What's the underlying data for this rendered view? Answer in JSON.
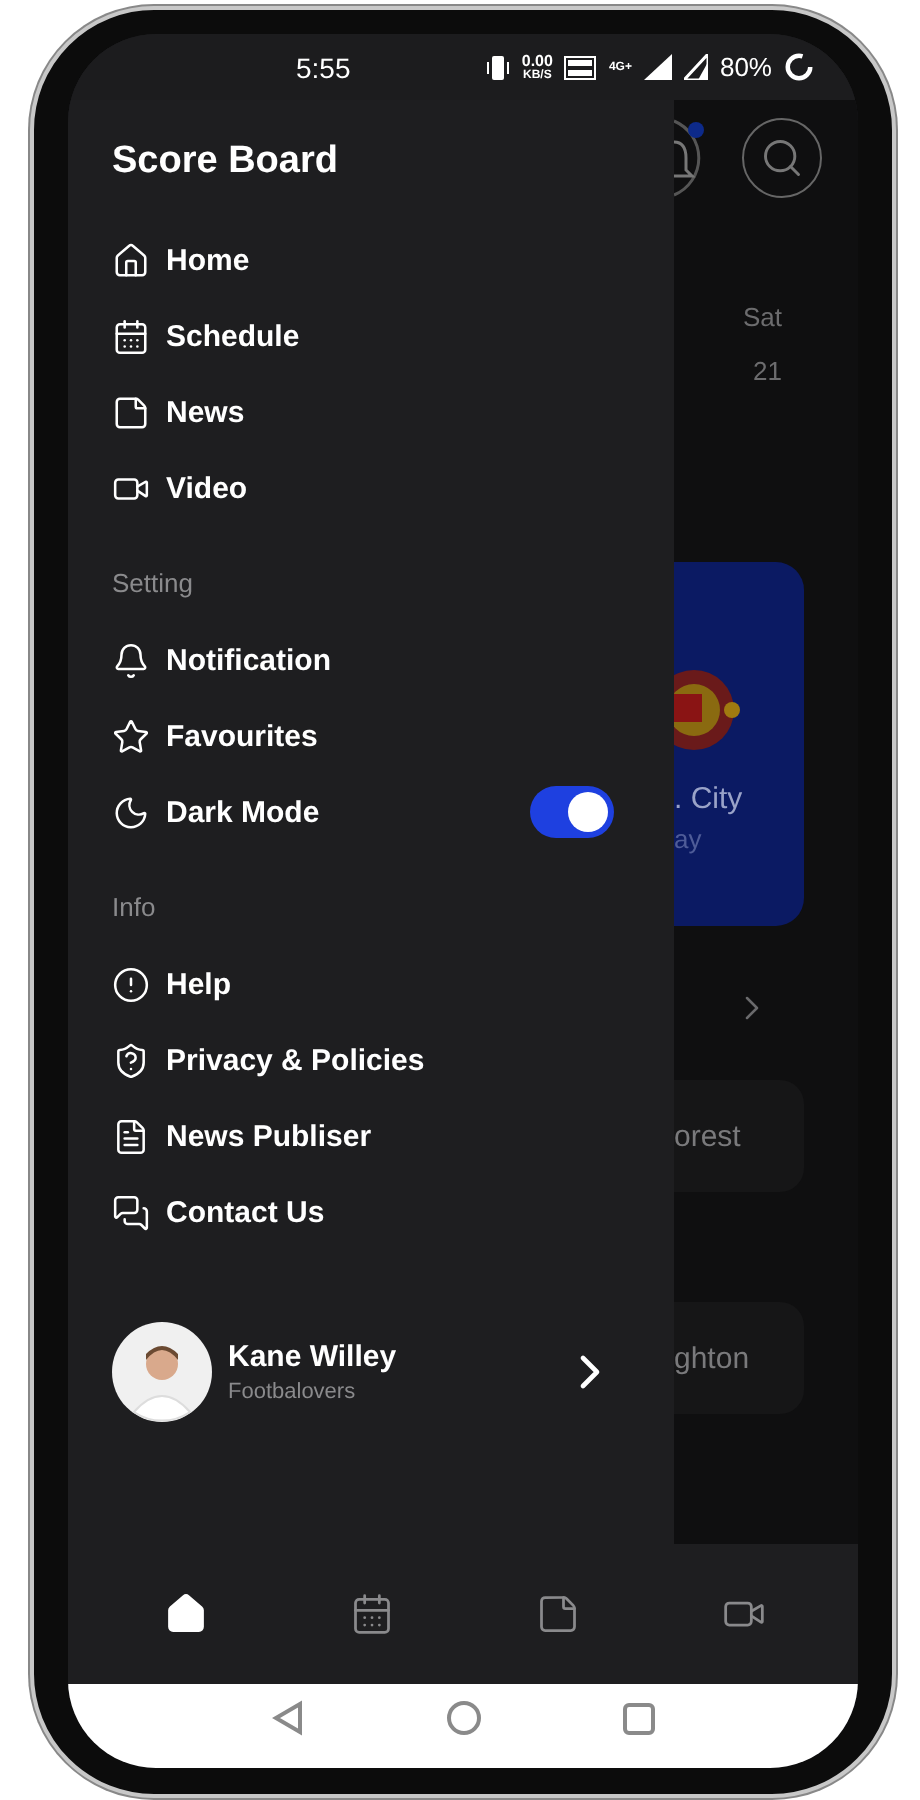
{
  "status_bar": {
    "time": "5:55",
    "data_rate": "0.00",
    "data_unit": "KB/S",
    "network_type": "4G+",
    "battery": "80%"
  },
  "drawer": {
    "title": "Score Board",
    "sections": [
      {
        "items": [
          {
            "kind": "link",
            "label": "Home"
          },
          {
            "kind": "link",
            "label": "Schedule"
          },
          {
            "kind": "link",
            "label": "News"
          },
          {
            "kind": "link",
            "label": "Video"
          }
        ]
      },
      {
        "heading": "Setting",
        "items": [
          {
            "kind": "link",
            "label": "Notification"
          },
          {
            "kind": "link",
            "label": "Favourites"
          },
          {
            "kind": "toggle",
            "label": "Dark Mode",
            "on": true
          }
        ]
      },
      {
        "heading": "Info",
        "items": [
          {
            "kind": "link",
            "label": "Help"
          },
          {
            "kind": "link",
            "label": "Privacy & Policies"
          },
          {
            "kind": "link",
            "label": "News Publiser"
          },
          {
            "kind": "link",
            "label": "Contact Us"
          }
        ]
      }
    ],
    "profile": {
      "name": "Kane Willey",
      "subtitle": "Footbalovers"
    }
  },
  "background": {
    "has_unread": true,
    "weekday": "Sat",
    "date": "21",
    "match_card": {
      "team": ". City",
      "venue": "ay"
    },
    "fixtures": [
      "orest",
      "ghton"
    ]
  },
  "bottom_nav": [
    {
      "selected": true
    },
    {
      "selected": false
    },
    {
      "selected": false
    },
    {
      "selected": false
    }
  ]
}
